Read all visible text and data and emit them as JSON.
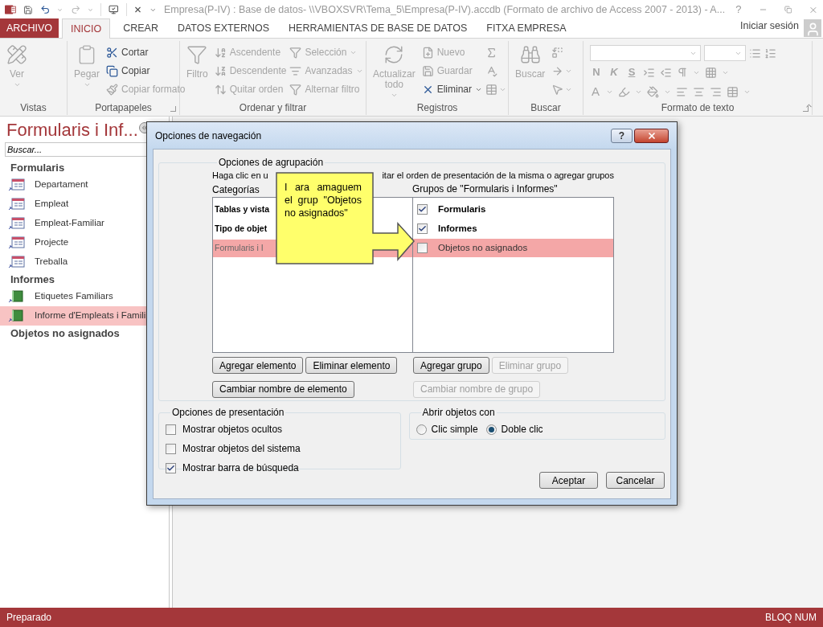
{
  "window": {
    "title": "Empresa(P-IV) : Base de datos- \\\\VBOXSVR\\Tema_5\\Empresa(P-IV).accdb (Formato de archivo de Access 2007 - 2013) - A...",
    "help": "?"
  },
  "ribbon_tabs": [
    {
      "label": "ARCHIVO",
      "kind": "file",
      "selected": false
    },
    {
      "label": "INICIO",
      "kind": "tab",
      "selected": true
    },
    {
      "label": "CREAR",
      "kind": "tab",
      "selected": false
    },
    {
      "label": "DATOS EXTERNOS",
      "kind": "tab",
      "selected": false
    },
    {
      "label": "HERRAMIENTAS DE BASE DE DATOS",
      "kind": "tab",
      "selected": false
    },
    {
      "label": "FITXA EMPRESA",
      "kind": "tab",
      "selected": false
    }
  ],
  "account": "Iniciar sesión",
  "ribbon_groups": [
    {
      "label": "Vistas",
      "kind": "commands",
      "columns": [
        [
          {
            "kind": "large",
            "label": "Ver",
            "disabled": true,
            "dropdown": true
          }
        ]
      ]
    },
    {
      "label": "Portapapeles",
      "kind": "commands",
      "launcher": true,
      "columns": [
        [
          {
            "kind": "large",
            "label": "Pegar",
            "disabled": true,
            "dropdown": true
          }
        ],
        [
          {
            "kind": "small",
            "label": "Cortar",
            "disabled": false
          },
          {
            "kind": "small",
            "label": "Copiar",
            "disabled": false
          },
          {
            "kind": "small",
            "label": "Copiar formato",
            "disabled": true
          }
        ]
      ]
    },
    {
      "label": "Ordenar y filtrar",
      "kind": "commands",
      "columns": [
        [
          {
            "kind": "large",
            "label": "Filtro",
            "disabled": true
          }
        ],
        [
          {
            "kind": "small",
            "label": "Ascendente",
            "disabled": true
          },
          {
            "kind": "small",
            "label": "Descendente",
            "disabled": true
          },
          {
            "kind": "small",
            "label": "Quitar orden",
            "disabled": true
          }
        ],
        [
          {
            "kind": "small",
            "label": "Selección",
            "disabled": true,
            "dropdown": true
          },
          {
            "kind": "small",
            "label": "Avanzadas",
            "disabled": true,
            "dropdown": true
          },
          {
            "kind": "small",
            "label": "Alternar filtro",
            "disabled": true
          }
        ]
      ]
    },
    {
      "label": "Registros",
      "kind": "commands",
      "columns": [
        [
          {
            "kind": "large",
            "label": "Actualizar todo",
            "disabled": true,
            "dropdown": true
          }
        ],
        [
          {
            "kind": "small",
            "label": "Nuevo",
            "disabled": true
          },
          {
            "kind": "small",
            "label": "Guardar",
            "disabled": true
          },
          {
            "kind": "small",
            "label": "Eliminar",
            "disabled": false,
            "dropdown": true
          }
        ],
        [
          {
            "kind": "icon",
            "disabled": true
          },
          {
            "kind": "icon",
            "disabled": true
          },
          {
            "kind": "icon",
            "disabled": true,
            "dropdown": true
          }
        ]
      ]
    },
    {
      "label": "Buscar",
      "kind": "commands",
      "columns": [
        [
          {
            "kind": "large",
            "label": "Buscar",
            "disabled": true
          }
        ],
        [
          {
            "kind": "icon",
            "disabled": true
          },
          {
            "kind": "icon",
            "disabled": true,
            "dropdown": true
          },
          {
            "kind": "icon",
            "disabled": true,
            "dropdown": true
          }
        ]
      ]
    },
    {
      "label": "Formato de texto",
      "kind": "text_format",
      "launcher": true,
      "style_buttons": [
        "N",
        "K",
        "S"
      ],
      "font_color": "A"
    }
  ],
  "nav_pane": {
    "title": "Formularis i Inf...",
    "search_placeholder": "Buscar...",
    "groups": [
      {
        "label": "Formularis",
        "items": [
          {
            "label": "Departament",
            "kind": "form",
            "selected": false
          },
          {
            "label": "Empleat",
            "kind": "form",
            "selected": false
          },
          {
            "label": "Empleat-Familiar",
            "kind": "form",
            "selected": false
          },
          {
            "label": "Projecte",
            "kind": "form",
            "selected": false
          },
          {
            "label": "Treballa",
            "kind": "form",
            "selected": false
          }
        ]
      },
      {
        "label": "Informes",
        "items": [
          {
            "label": "Etiquetes Familiars",
            "kind": "report",
            "selected": false
          },
          {
            "label": "Informe d'Empleats i Famili",
            "kind": "report",
            "selected": true
          }
        ]
      },
      {
        "label": "Objetos no asignados"
      }
    ]
  },
  "dialog": {
    "title": "Opciones de navegación",
    "help": "?",
    "grouping": {
      "legend": "Opciones de agrupación",
      "instructions": [
        "Haga clic en u",
        "itar el orden de presentación de la misma o agregar grupos"
      ],
      "categories_label": "Categorías",
      "categories": [
        {
          "label": "Tablas y vista",
          "selected": false
        },
        {
          "label": "Tipo de objet",
          "selected": false
        },
        {
          "label": "Formularis i I",
          "selected": true
        }
      ],
      "groups_label": "Grupos de \"Formularis i Informes\"",
      "groups": [
        {
          "label": "Formularis",
          "checked": true,
          "selected": false
        },
        {
          "label": "Informes",
          "checked": true,
          "selected": false
        },
        {
          "label": "Objetos no asignados",
          "checked": false,
          "selected": true
        }
      ],
      "category_buttons": [
        {
          "label": "Agregar elemento",
          "disabled": false
        },
        {
          "label": "Eliminar elemento",
          "disabled": false
        },
        {
          "label": "Cambiar nombre de elemento",
          "disabled": false
        }
      ],
      "group_buttons": [
        {
          "label": "Agregar grupo",
          "disabled": false
        },
        {
          "label": "Eliminar grupo",
          "disabled": true
        },
        {
          "label": "Cambiar nombre de grupo",
          "disabled": true
        }
      ]
    },
    "display": {
      "legend": "Opciones de presentación",
      "options": [
        {
          "label": "Mostrar objetos ocultos",
          "checked": false
        },
        {
          "label": "Mostrar objetos del sistema",
          "checked": false
        },
        {
          "label": "Mostrar barra de búsqueda",
          "checked": true
        }
      ]
    },
    "open_with": {
      "legend": "Abrir objetos con",
      "options": [
        {
          "label": "Clic simple",
          "selected": false
        },
        {
          "label": "Doble clic",
          "selected": true
        }
      ]
    },
    "buttons": [
      "Aceptar",
      "Cancelar"
    ]
  },
  "callout": {
    "text": "I ara amaguem el grup \"Objetos no asignados\""
  },
  "status_bar": {
    "left": "Preparado",
    "right": "BLOQ NUM"
  }
}
